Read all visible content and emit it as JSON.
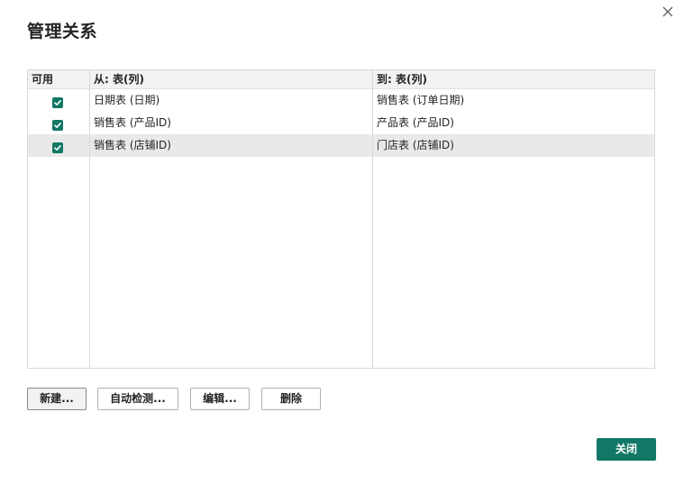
{
  "dialog": {
    "title": "管理关系",
    "close_icon": "close-icon"
  },
  "grid": {
    "headers": {
      "enabled": "可用",
      "from": "从: 表(列)",
      "to": "到: 表(列)"
    },
    "rows": [
      {
        "enabled": true,
        "from": "日期表 (日期)",
        "to": "销售表 (订单日期)",
        "selected": false
      },
      {
        "enabled": true,
        "from": "销售表 (产品ID)",
        "to": "产品表 (产品ID)",
        "selected": false
      },
      {
        "enabled": true,
        "from": "销售表 (店铺ID)",
        "to": "门店表 (店铺ID)",
        "selected": true
      }
    ]
  },
  "buttons": {
    "new": "新建...",
    "autodetect": "自动检测...",
    "edit": "编辑...",
    "delete": "删除",
    "close": "关闭"
  },
  "colors": {
    "accent": "#117865",
    "selected_row": "#e9e9e9",
    "header_bg": "#f2f2f2",
    "border": "#d9d9d9"
  }
}
